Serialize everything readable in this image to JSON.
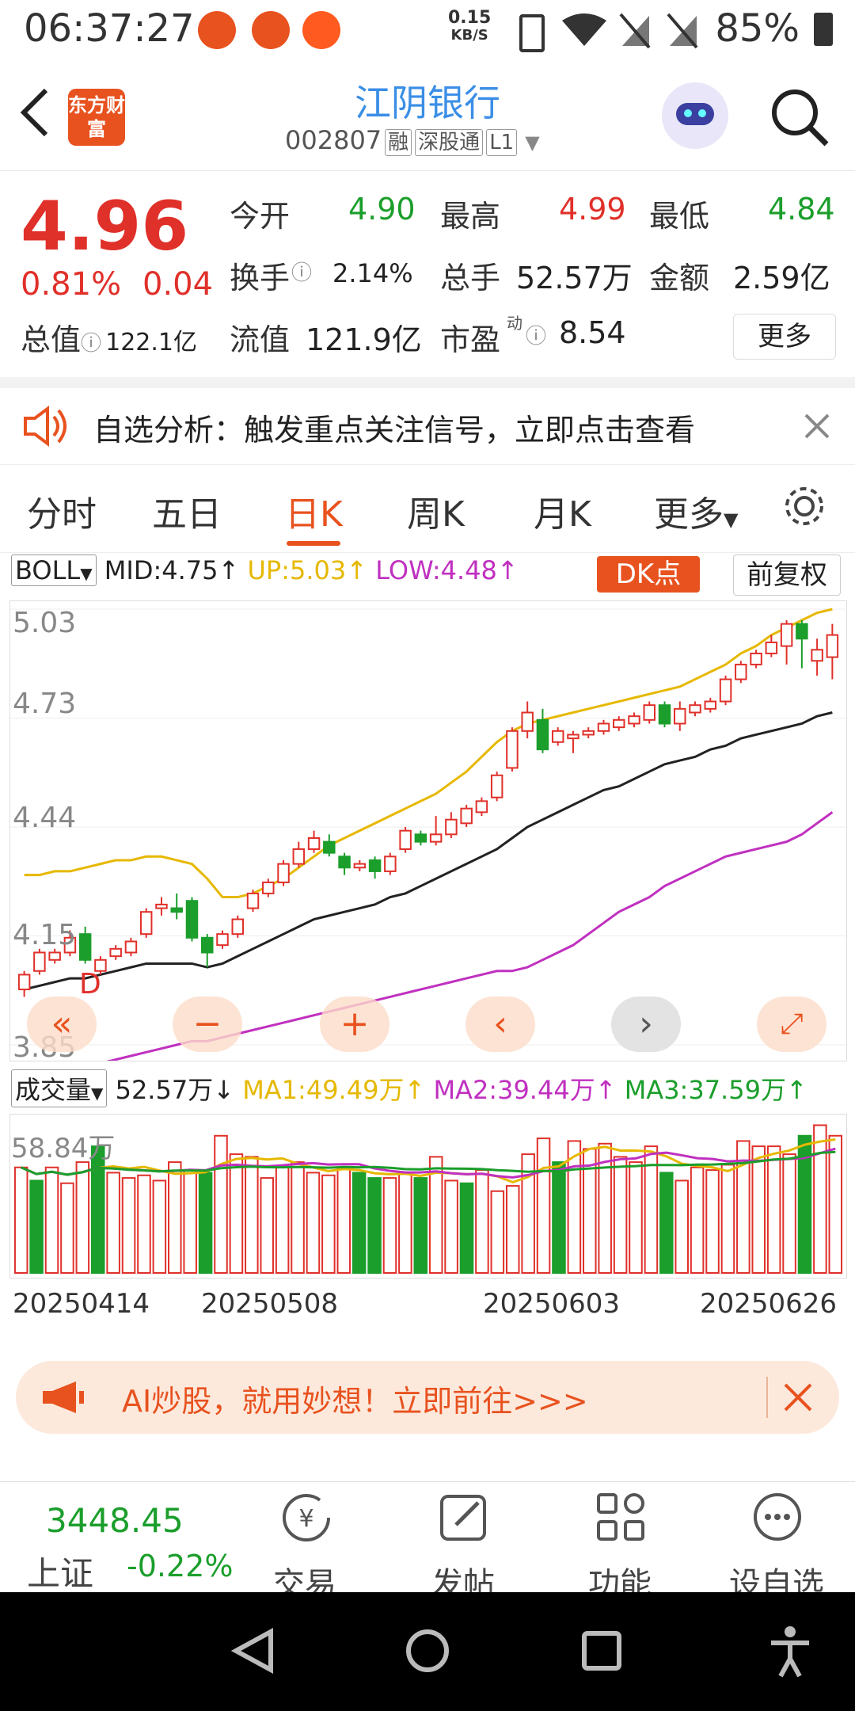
{
  "status_bar": {
    "time": "06:37:27",
    "net_speed_value": "0.15",
    "net_speed_unit": "KB/S",
    "battery": "85%"
  },
  "header": {
    "back_icon": "chevron-left-icon",
    "logo_text": "东方财富",
    "title": "江阴银行",
    "code": "002807",
    "tags": [
      "融",
      "深股通",
      "L1"
    ]
  },
  "quote": {
    "price": "4.96",
    "change_pct": "0.81%",
    "change": "0.04",
    "market_cap_label": "总值",
    "market_cap_value": "122.1亿",
    "stats": {
      "open_label": "今开",
      "open_value": "4.90",
      "high_label": "最高",
      "high_value": "4.99",
      "low_label": "最低",
      "low_value": "4.84",
      "turnover_label": "换手",
      "turnover_value": "2.14%",
      "volume_label": "总手",
      "volume_value": "52.57万",
      "amount_label": "金额",
      "amount_value": "2.59亿",
      "float_label": "流值",
      "float_value": "121.9亿",
      "pe_label": "市盈",
      "pe_sup": "动",
      "pe_value": "8.54"
    },
    "more_button": "更多"
  },
  "notice": {
    "text": "自选分析：触发重点关注信号，立即点击查看"
  },
  "tabs": [
    "分时",
    "五日",
    "日K",
    "周K",
    "月K",
    "更多"
  ],
  "active_tab": "日K",
  "indicator": {
    "name": "BOLL",
    "mid": "MID:4.75",
    "up": "UP:5.03",
    "low": "LOW:4.48",
    "dk_button": "DK点",
    "fuquan_button": "前复权",
    "colors": {
      "mid": "#222222",
      "up": "#e6b800",
      "low": "#c030c0"
    }
  },
  "kline_axis": [
    "5.03",
    "4.73",
    "4.44",
    "4.15",
    "3.85"
  ],
  "kline_marker": "D",
  "volume": {
    "name": "成交量",
    "value": "52.57万",
    "ma1": "MA1:49.49万",
    "ma2": "MA2:39.44万",
    "ma3": "MA3:37.59万",
    "axis_top": "58.84万",
    "colors": {
      "ma1": "#e6b800",
      "ma2": "#c030c0",
      "ma3": "#1b9e2b"
    }
  },
  "dates": [
    "20250414",
    "20250508",
    "20250603",
    "20250626"
  ],
  "ad": {
    "text": "AI炒股，就用妙想！立即前往>>>"
  },
  "toolbar": {
    "index_value": "3448.45",
    "index_name": "上证",
    "index_change": "-0.22%",
    "items": [
      "交易",
      "发帖",
      "功能",
      "设自选"
    ]
  },
  "chart_data": {
    "type": "candlestick",
    "y_range": [
      3.85,
      5.03
    ],
    "up_color": "#e0302a",
    "down_color": "#1b9e2b",
    "candles": [
      {
        "o": 4.0,
        "c": 4.04,
        "h": 4.05,
        "l": 3.98
      },
      {
        "o": 4.05,
        "c": 4.1,
        "h": 4.11,
        "l": 4.04
      },
      {
        "o": 4.08,
        "c": 4.1,
        "h": 4.11,
        "l": 4.07
      },
      {
        "o": 4.1,
        "c": 4.14,
        "h": 4.16,
        "l": 4.09
      },
      {
        "o": 4.15,
        "c": 4.08,
        "h": 4.17,
        "l": 4.07
      },
      {
        "o": 4.05,
        "c": 4.08,
        "h": 4.09,
        "l": 4.04
      },
      {
        "o": 4.09,
        "c": 4.11,
        "h": 4.12,
        "l": 4.08
      },
      {
        "o": 4.1,
        "c": 4.13,
        "h": 4.14,
        "l": 4.09
      },
      {
        "o": 4.15,
        "c": 4.21,
        "h": 4.22,
        "l": 4.14
      },
      {
        "o": 4.22,
        "c": 4.23,
        "h": 4.25,
        "l": 4.2
      },
      {
        "o": 4.22,
        "c": 4.21,
        "h": 4.26,
        "l": 4.19
      },
      {
        "o": 4.24,
        "c": 4.14,
        "h": 4.25,
        "l": 4.13
      },
      {
        "o": 4.14,
        "c": 4.1,
        "h": 4.15,
        "l": 4.06
      },
      {
        "o": 4.12,
        "c": 4.15,
        "h": 4.16,
        "l": 4.11
      },
      {
        "o": 4.15,
        "c": 4.19,
        "h": 4.2,
        "l": 4.14
      },
      {
        "o": 4.22,
        "c": 4.26,
        "h": 4.27,
        "l": 4.21
      },
      {
        "o": 4.26,
        "c": 4.29,
        "h": 4.3,
        "l": 4.25
      },
      {
        "o": 4.29,
        "c": 4.34,
        "h": 4.35,
        "l": 4.28
      },
      {
        "o": 4.34,
        "c": 4.38,
        "h": 4.4,
        "l": 4.33
      },
      {
        "o": 4.38,
        "c": 4.41,
        "h": 4.43,
        "l": 4.37
      },
      {
        "o": 4.4,
        "c": 4.37,
        "h": 4.42,
        "l": 4.36
      },
      {
        "o": 4.36,
        "c": 4.33,
        "h": 4.37,
        "l": 4.31
      },
      {
        "o": 4.33,
        "c": 4.34,
        "h": 4.35,
        "l": 4.32
      },
      {
        "o": 4.35,
        "c": 4.32,
        "h": 4.36,
        "l": 4.3
      },
      {
        "o": 4.32,
        "c": 4.36,
        "h": 4.37,
        "l": 4.31
      },
      {
        "o": 4.38,
        "c": 4.43,
        "h": 4.44,
        "l": 4.37
      },
      {
        "o": 4.42,
        "c": 4.4,
        "h": 4.43,
        "l": 4.39
      },
      {
        "o": 4.4,
        "c": 4.42,
        "h": 4.47,
        "l": 4.39
      },
      {
        "o": 4.42,
        "c": 4.46,
        "h": 4.48,
        "l": 4.41
      },
      {
        "o": 4.45,
        "c": 4.49,
        "h": 4.5,
        "l": 4.44
      },
      {
        "o": 4.48,
        "c": 4.51,
        "h": 4.52,
        "l": 4.47
      },
      {
        "o": 4.52,
        "c": 4.58,
        "h": 4.59,
        "l": 4.51
      },
      {
        "o": 4.6,
        "c": 4.7,
        "h": 4.71,
        "l": 4.59
      },
      {
        "o": 4.7,
        "c": 4.75,
        "h": 4.78,
        "l": 4.68
      },
      {
        "o": 4.73,
        "c": 4.65,
        "h": 4.76,
        "l": 4.64
      },
      {
        "o": 4.67,
        "c": 4.7,
        "h": 4.71,
        "l": 4.66
      },
      {
        "o": 4.68,
        "c": 4.69,
        "h": 4.7,
        "l": 4.64
      },
      {
        "o": 4.69,
        "c": 4.7,
        "h": 4.71,
        "l": 4.68
      },
      {
        "o": 4.7,
        "c": 4.72,
        "h": 4.73,
        "l": 4.69
      },
      {
        "o": 4.71,
        "c": 4.73,
        "h": 4.74,
        "l": 4.7
      },
      {
        "o": 4.72,
        "c": 4.74,
        "h": 4.75,
        "l": 4.71
      },
      {
        "o": 4.73,
        "c": 4.77,
        "h": 4.78,
        "l": 4.72
      },
      {
        "o": 4.77,
        "c": 4.72,
        "h": 4.78,
        "l": 4.71
      },
      {
        "o": 4.72,
        "c": 4.76,
        "h": 4.78,
        "l": 4.7
      },
      {
        "o": 4.75,
        "c": 4.77,
        "h": 4.78,
        "l": 4.74
      },
      {
        "o": 4.76,
        "c": 4.78,
        "h": 4.79,
        "l": 4.75
      },
      {
        "o": 4.78,
        "c": 4.84,
        "h": 4.85,
        "l": 4.77
      },
      {
        "o": 4.84,
        "c": 4.88,
        "h": 4.89,
        "l": 4.83
      },
      {
        "o": 4.88,
        "c": 4.91,
        "h": 4.92,
        "l": 4.87
      },
      {
        "o": 4.91,
        "c": 4.94,
        "h": 4.96,
        "l": 4.9
      },
      {
        "o": 4.93,
        "c": 4.99,
        "h": 5.0,
        "l": 4.88
      },
      {
        "o": 4.99,
        "c": 4.95,
        "h": 5.0,
        "l": 4.87
      },
      {
        "o": 4.89,
        "c": 4.92,
        "h": 4.95,
        "l": 4.85
      },
      {
        "o": 4.9,
        "c": 4.96,
        "h": 4.99,
        "l": 4.84
      }
    ],
    "boll_up": [
      4.31,
      4.31,
      4.32,
      4.32,
      4.33,
      4.34,
      4.35,
      4.35,
      4.36,
      4.36,
      4.35,
      4.34,
      4.3,
      4.25,
      4.25,
      4.26,
      4.28,
      4.3,
      4.33,
      4.36,
      4.39,
      4.41,
      4.43,
      4.45,
      4.47,
      4.49,
      4.51,
      4.53,
      4.56,
      4.59,
      4.63,
      4.67,
      4.7,
      4.72,
      4.73,
      4.74,
      4.75,
      4.76,
      4.77,
      4.78,
      4.79,
      4.8,
      4.81,
      4.82,
      4.84,
      4.86,
      4.88,
      4.91,
      4.93,
      4.96,
      4.98,
      5.0,
      5.02,
      5.03
    ],
    "boll_mid": [
      4.0,
      4.01,
      4.02,
      4.03,
      4.03,
      4.04,
      4.05,
      4.06,
      4.07,
      4.07,
      4.07,
      4.07,
      4.06,
      4.07,
      4.09,
      4.11,
      4.13,
      4.15,
      4.17,
      4.19,
      4.2,
      4.21,
      4.22,
      4.23,
      4.25,
      4.26,
      4.28,
      4.3,
      4.32,
      4.34,
      4.36,
      4.38,
      4.41,
      4.44,
      4.46,
      4.48,
      4.5,
      4.52,
      4.54,
      4.55,
      4.57,
      4.59,
      4.61,
      4.62,
      4.63,
      4.65,
      4.66,
      4.68,
      4.69,
      4.7,
      4.71,
      4.72,
      4.74,
      4.75
    ],
    "boll_low": [
      3.75,
      3.76,
      3.77,
      3.78,
      3.79,
      3.8,
      3.81,
      3.82,
      3.83,
      3.84,
      3.85,
      3.86,
      3.86,
      3.87,
      3.88,
      3.89,
      3.9,
      3.91,
      3.92,
      3.93,
      3.94,
      3.95,
      3.96,
      3.97,
      3.98,
      3.99,
      4.0,
      4.01,
      4.02,
      4.03,
      4.04,
      4.05,
      4.05,
      4.06,
      4.08,
      4.1,
      4.12,
      4.15,
      4.18,
      4.21,
      4.23,
      4.25,
      4.28,
      4.3,
      4.32,
      4.34,
      4.36,
      4.37,
      4.38,
      4.39,
      4.4,
      4.42,
      4.45,
      4.48
    ],
    "volumes": [
      40,
      35,
      40,
      34,
      42,
      48,
      38,
      36,
      37,
      35,
      42,
      39,
      38,
      52,
      45,
      44,
      36,
      40,
      42,
      38,
      37,
      40,
      38,
      36,
      36,
      38,
      36,
      44,
      35,
      34,
      39,
      31,
      33,
      45,
      51,
      42,
      50,
      47,
      49,
      44,
      42,
      48,
      38,
      35,
      40,
      39,
      41,
      50,
      48,
      48,
      45,
      52,
      56,
      52
    ],
    "volume_up": [
      true,
      false,
      true,
      true,
      true,
      false,
      true,
      true,
      true,
      true,
      true,
      true,
      false,
      true,
      true,
      true,
      true,
      true,
      true,
      true,
      true,
      true,
      false,
      false,
      true,
      true,
      false,
      true,
      true,
      false,
      true,
      true,
      true,
      true,
      true,
      false,
      true,
      true,
      true,
      true,
      true,
      true,
      false,
      true,
      true,
      true,
      true,
      true,
      true,
      true,
      true,
      false,
      true,
      true
    ],
    "volume_range": [
      0,
      58.84
    ]
  }
}
